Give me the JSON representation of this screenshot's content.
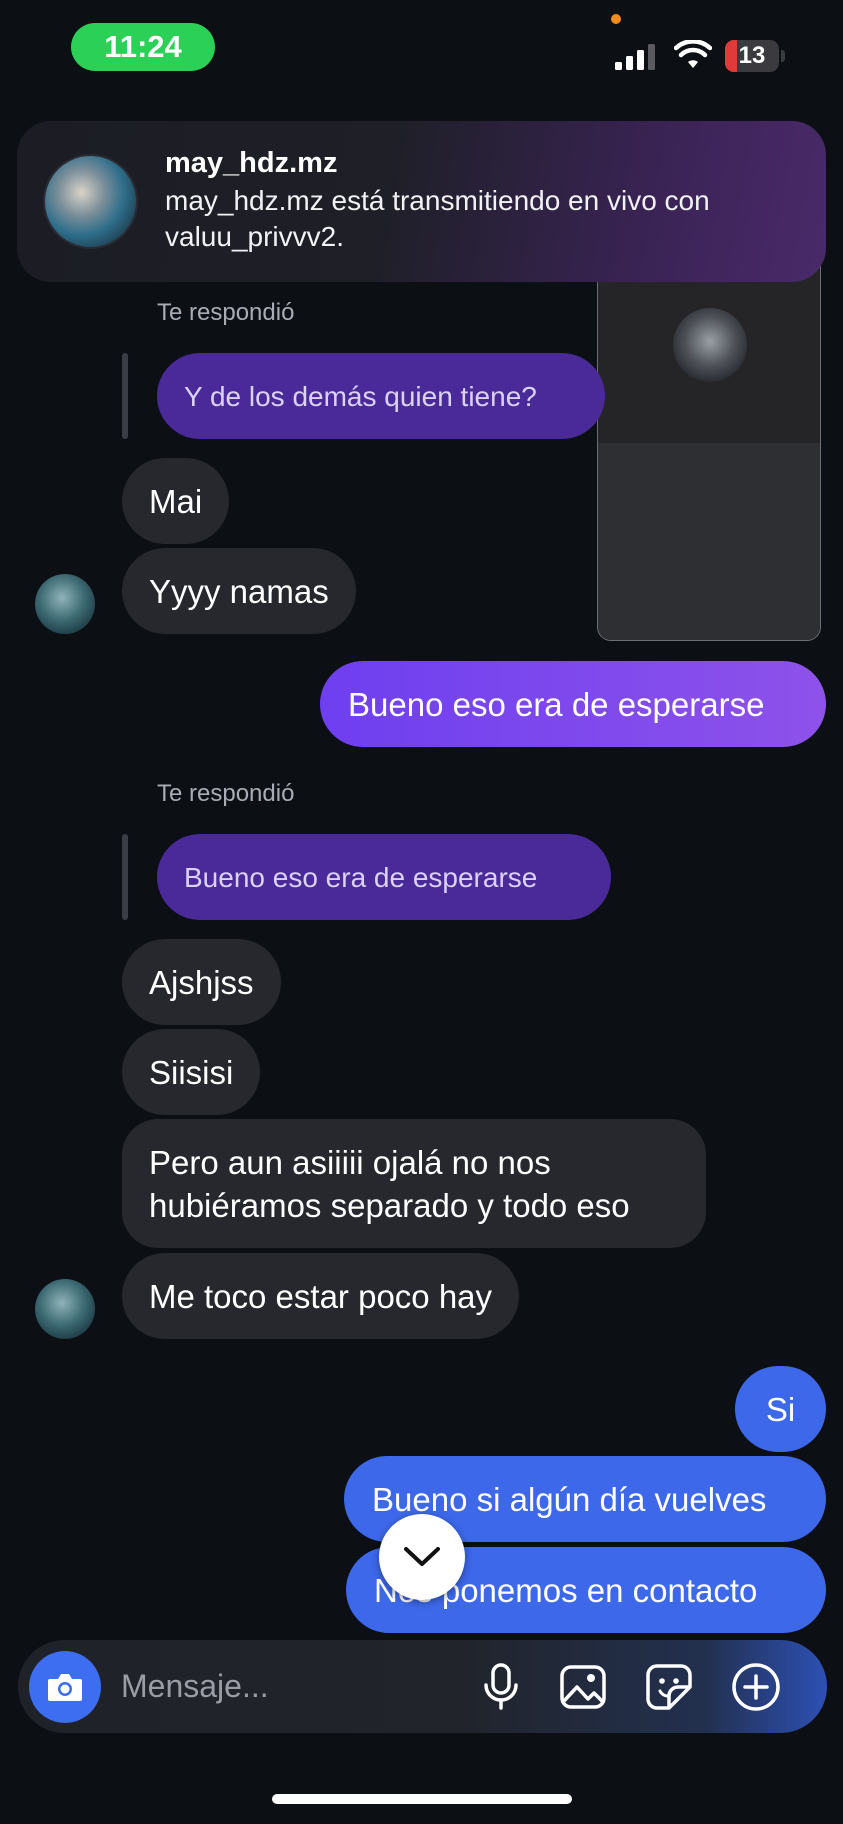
{
  "status_bar": {
    "time": "11:24",
    "battery": "13"
  },
  "notification": {
    "title": "may_hdz.mz",
    "text": "may_hdz.mz está transmitiendo en vivo con valuu_privvv2."
  },
  "thread": {
    "reply_label_1": "Te respondió",
    "quoted_1": "Y de los demás quien tiene?",
    "msg_mai": "Mai",
    "msg_yyyy": "Yyyy namas",
    "out_1": "Bueno eso era de esperarse",
    "reply_label_2": "Te respondió",
    "quoted_2": "Bueno eso era de esperarse",
    "msg_ajshjss": "Ajshjss",
    "msg_siisisi": "Siisisi",
    "msg_pero": "Pero aun asiiiii ojalá no nos hubiéramos separado y todo eso",
    "msg_metoco": "Me toco estar poco hay",
    "out_si": "Si",
    "out_bueno_si": "Bueno si algún día vuelves",
    "out_contacto": "Nos ponemos en contacto"
  },
  "composer": {
    "placeholder": "Mensaje..."
  },
  "icons": {
    "camera": "camera-icon",
    "mic": "microphone-icon",
    "gallery": "image-icon",
    "sticker": "sticker-icon",
    "add": "plus-circle-icon",
    "scroll": "chevron-down-icon"
  },
  "colors": {
    "background": "#0c0f14",
    "incoming": "#26282d",
    "outgoing_purple": "#7b47ee",
    "outgoing_blue": "#3d68ea",
    "quoted": "#4a2a99",
    "time_pill": "#2bd157"
  }
}
